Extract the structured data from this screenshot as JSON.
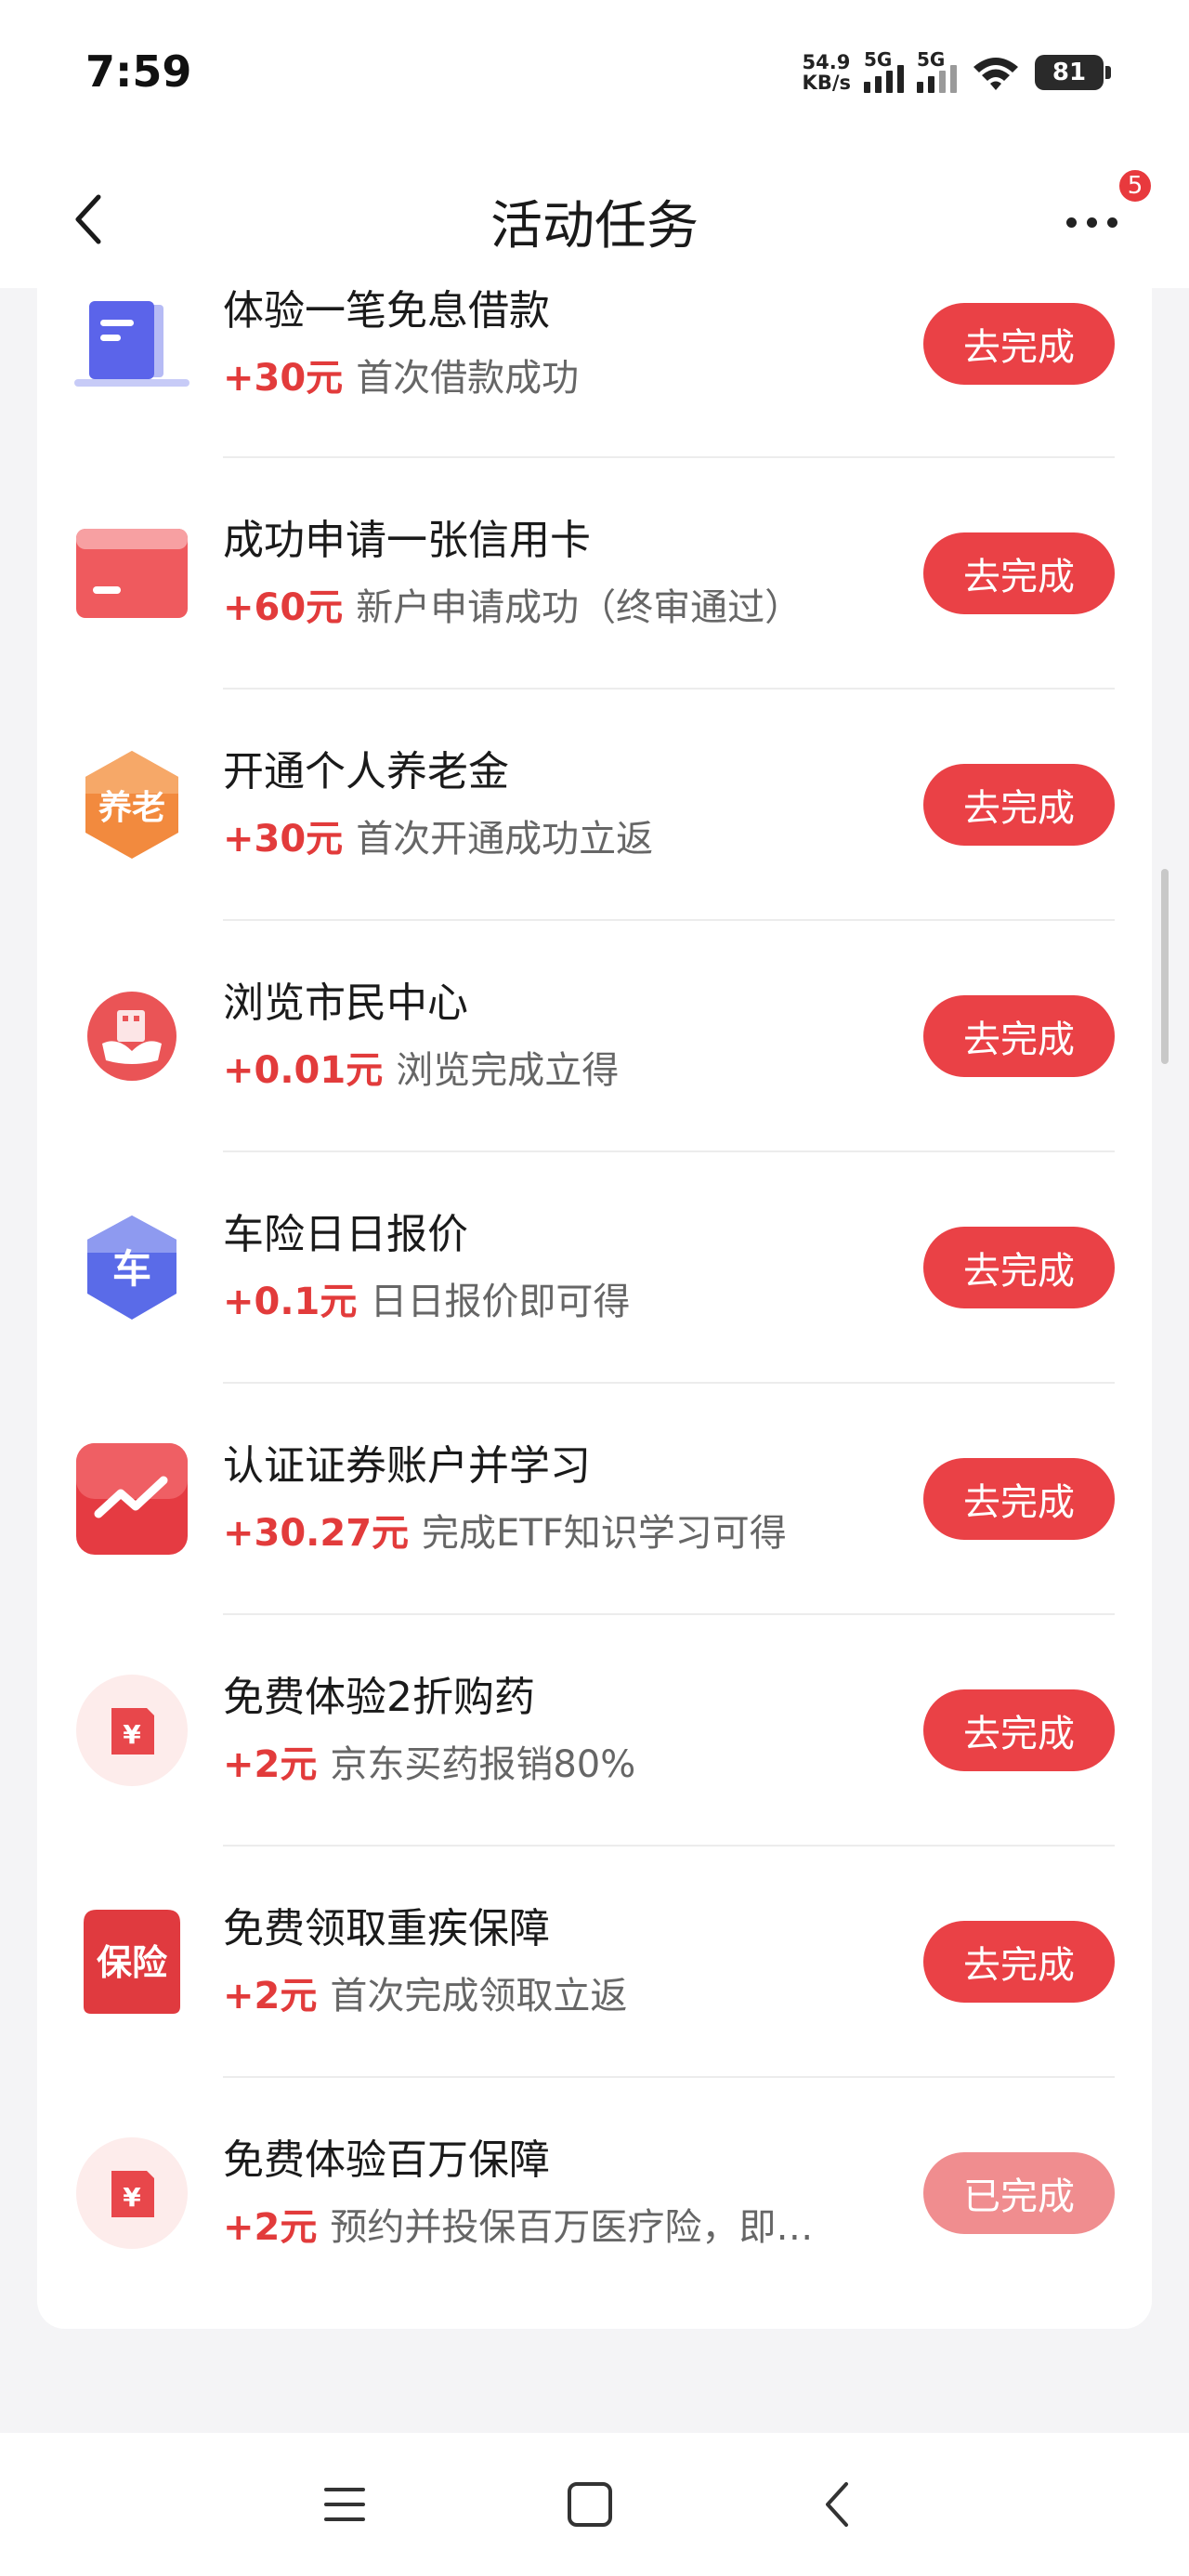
{
  "status_bar": {
    "time": "7:59",
    "net_speed_value": "54.9",
    "net_speed_unit": "KB/s",
    "sim1_label": "5G",
    "sim2_label": "5G",
    "battery": "81"
  },
  "header": {
    "title": "活动任务",
    "more_badge_count": "5"
  },
  "tasks": [
    {
      "title": "体验一笔免息借款",
      "reward": "+30元",
      "desc": "首次借款成功",
      "button": "去完成",
      "icon": "document-stack-icon",
      "status": "todo"
    },
    {
      "title": "成功申请一张信用卡",
      "reward": "+60元",
      "desc": "新户申请成功（终审通过）",
      "button": "去完成",
      "icon": "credit-card-icon",
      "status": "todo"
    },
    {
      "title": "开通个人养老金",
      "reward": "+30元",
      "desc": "首次开通成功立返",
      "button": "去完成",
      "icon": "pension-icon",
      "icon_text": "养老",
      "status": "todo"
    },
    {
      "title": "浏览市民中心",
      "reward": "+0.01元",
      "desc": "浏览完成立得",
      "button": "去完成",
      "icon": "citizen-center-icon",
      "status": "todo"
    },
    {
      "title": "车险日日报价",
      "reward": "+0.1元",
      "desc": "日日报价即可得",
      "button": "去完成",
      "icon": "car-insurance-icon",
      "icon_text": "车",
      "status": "todo"
    },
    {
      "title": "认证证券账户并学习",
      "reward": "+30.27元",
      "desc": "完成ETF知识学习可得",
      "button": "去完成",
      "icon": "stock-trend-icon",
      "status": "todo"
    },
    {
      "title": "免费体验2折购药",
      "reward": "+2元",
      "desc": "京东买药报销80%",
      "button": "去完成",
      "icon": "red-envelope-icon",
      "icon_text": "¥",
      "status": "todo"
    },
    {
      "title": "免费领取重疾保障",
      "reward": "+2元",
      "desc": "首次完成领取立返",
      "button": "去完成",
      "icon": "insurance-icon",
      "icon_text": "保险",
      "status": "todo"
    },
    {
      "title": "免费体验百万保障",
      "reward": "+2元",
      "desc": "预约并投保百万医疗险，即…",
      "button": "已完成",
      "icon": "red-envelope-icon",
      "icon_text": "¥",
      "status": "done"
    }
  ]
}
